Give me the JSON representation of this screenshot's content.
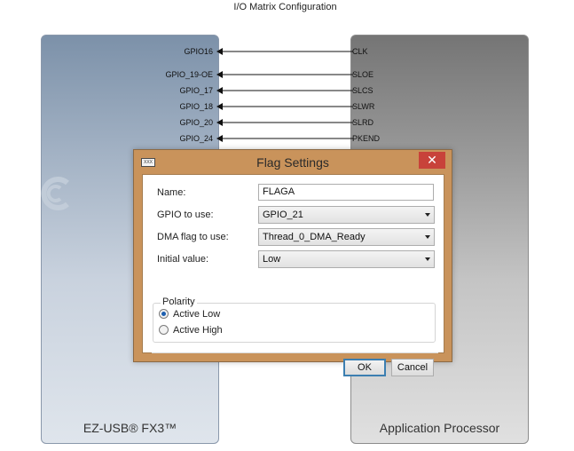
{
  "window_title": "I/O Matrix Configuration",
  "panels": {
    "left_label": "EZ-USB® FX3™",
    "right_label": "Application Processor"
  },
  "connections": [
    {
      "gpio": "GPIO16",
      "signal": "CLK"
    },
    {
      "gpio": "GPIO_19-OE",
      "signal": "SLOE"
    },
    {
      "gpio": "GPIO_17",
      "signal": "SLCS"
    },
    {
      "gpio": "GPIO_18",
      "signal": "SLWR"
    },
    {
      "gpio": "GPIO_20",
      "signal": "SLRD"
    },
    {
      "gpio": "GPIO_24",
      "signal": "PKEND"
    }
  ],
  "dialog": {
    "title": "Flag Settings",
    "icon_text": "XXX",
    "close_glyph": "✕",
    "fields": {
      "name_label": "Name:",
      "name_value": "FLAGA",
      "gpio_label": "GPIO to use:",
      "gpio_value": "GPIO_21",
      "dma_label": "DMA flag to use:",
      "dma_value": "Thread_0_DMA_Ready",
      "initial_label": "Initial value:",
      "initial_value": "Low"
    },
    "polarity": {
      "legend": "Polarity",
      "options": [
        "Active Low",
        "Active High"
      ],
      "selected": "Active Low"
    },
    "buttons": {
      "ok": "OK",
      "cancel": "Cancel"
    }
  },
  "colors": {
    "dialog_frame": "#c9935b",
    "close_button": "#c8423a",
    "left_panel": "#7c91a9",
    "right_panel": "#757575",
    "radio_selected": "#1d5fb0"
  },
  "icons": [
    "close-icon",
    "dropdown-arrow-icon",
    "app-icon",
    "cypress-logo-icon",
    "arrow-left-icon"
  ]
}
